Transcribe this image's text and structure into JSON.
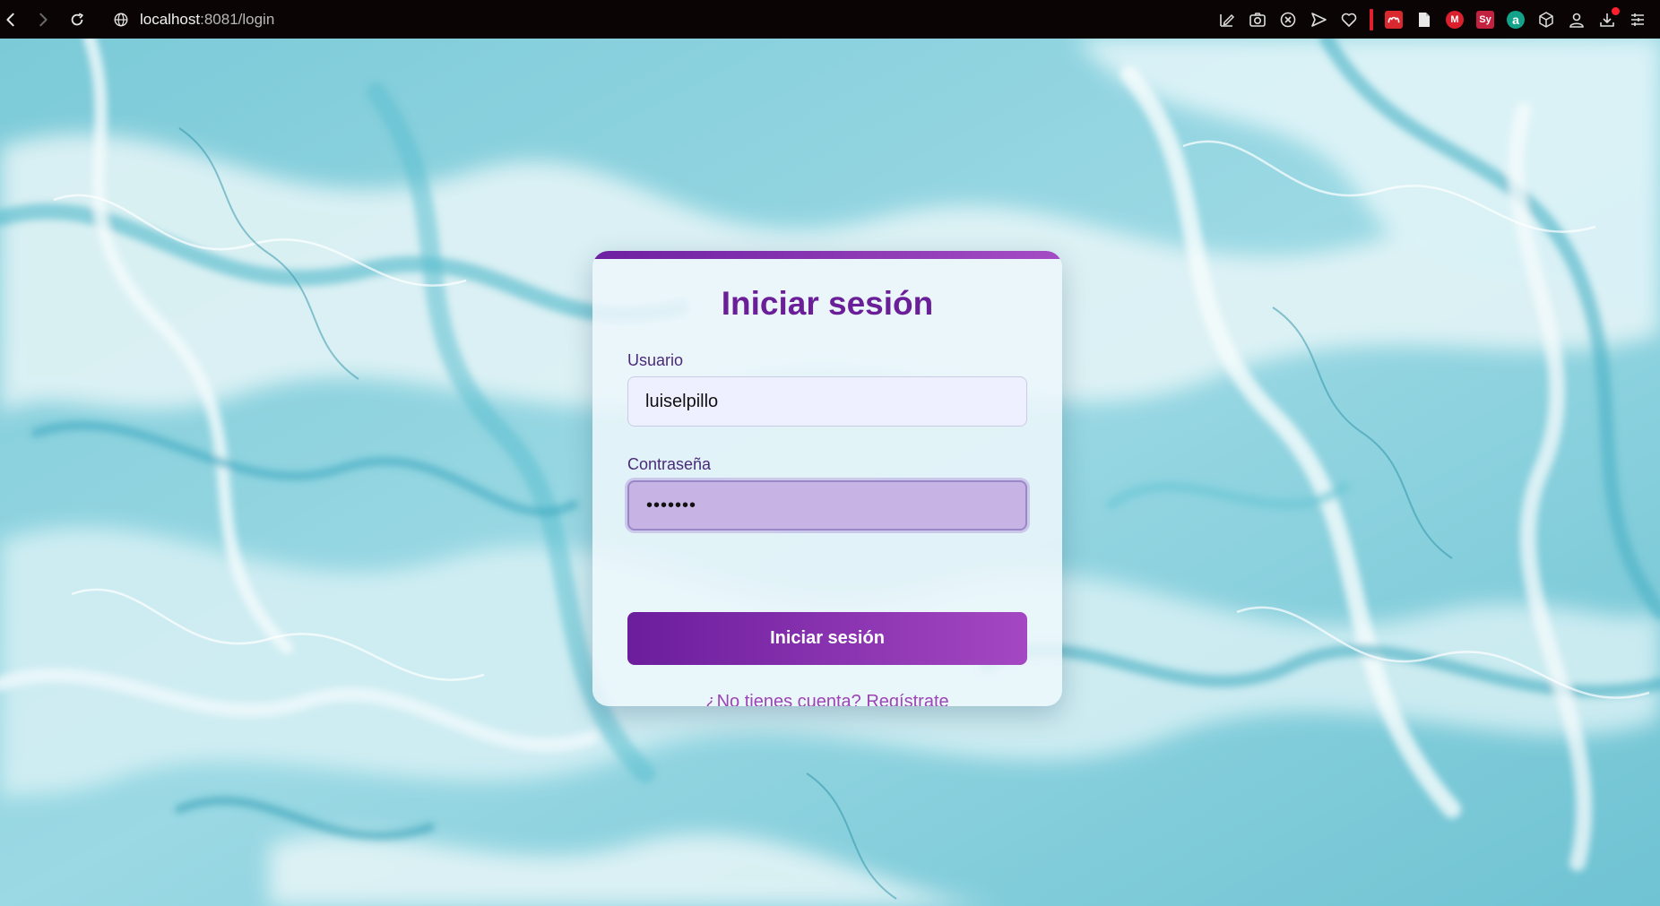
{
  "browser": {
    "url_host": "localhost",
    "url_path": ":8081/login",
    "extensions": [
      {
        "name": "edit-icon"
      },
      {
        "name": "camera-icon"
      },
      {
        "name": "close-circle-icon"
      },
      {
        "name": "send-icon"
      },
      {
        "name": "heart-icon"
      },
      {
        "name": "separator"
      },
      {
        "name": "mendeley-icon",
        "color": "#d9292e"
      },
      {
        "name": "document-icon"
      },
      {
        "name": "m-icon",
        "label": "M",
        "color": "#d9202c"
      },
      {
        "name": "sy-icon",
        "label": "Sy",
        "color": "#c2213f"
      },
      {
        "name": "a-icon",
        "label": "a",
        "color": "#12a38a"
      },
      {
        "name": "cube-icon"
      },
      {
        "name": "profile-icon"
      },
      {
        "name": "download-icon"
      },
      {
        "name": "menu-icon"
      }
    ]
  },
  "login": {
    "title": "Iniciar sesión",
    "username_label": "Usuario",
    "username_value": "luiselpillo",
    "password_label": "Contraseña",
    "password_value": "•••••••",
    "submit_label": "Iniciar sesión",
    "register_link": "¿No tienes cuenta? Regístrate"
  },
  "colors": {
    "accent": "#6a1f98",
    "accent_light": "#a547c2",
    "link": "#9b44b6",
    "background": "#8fd3df"
  }
}
